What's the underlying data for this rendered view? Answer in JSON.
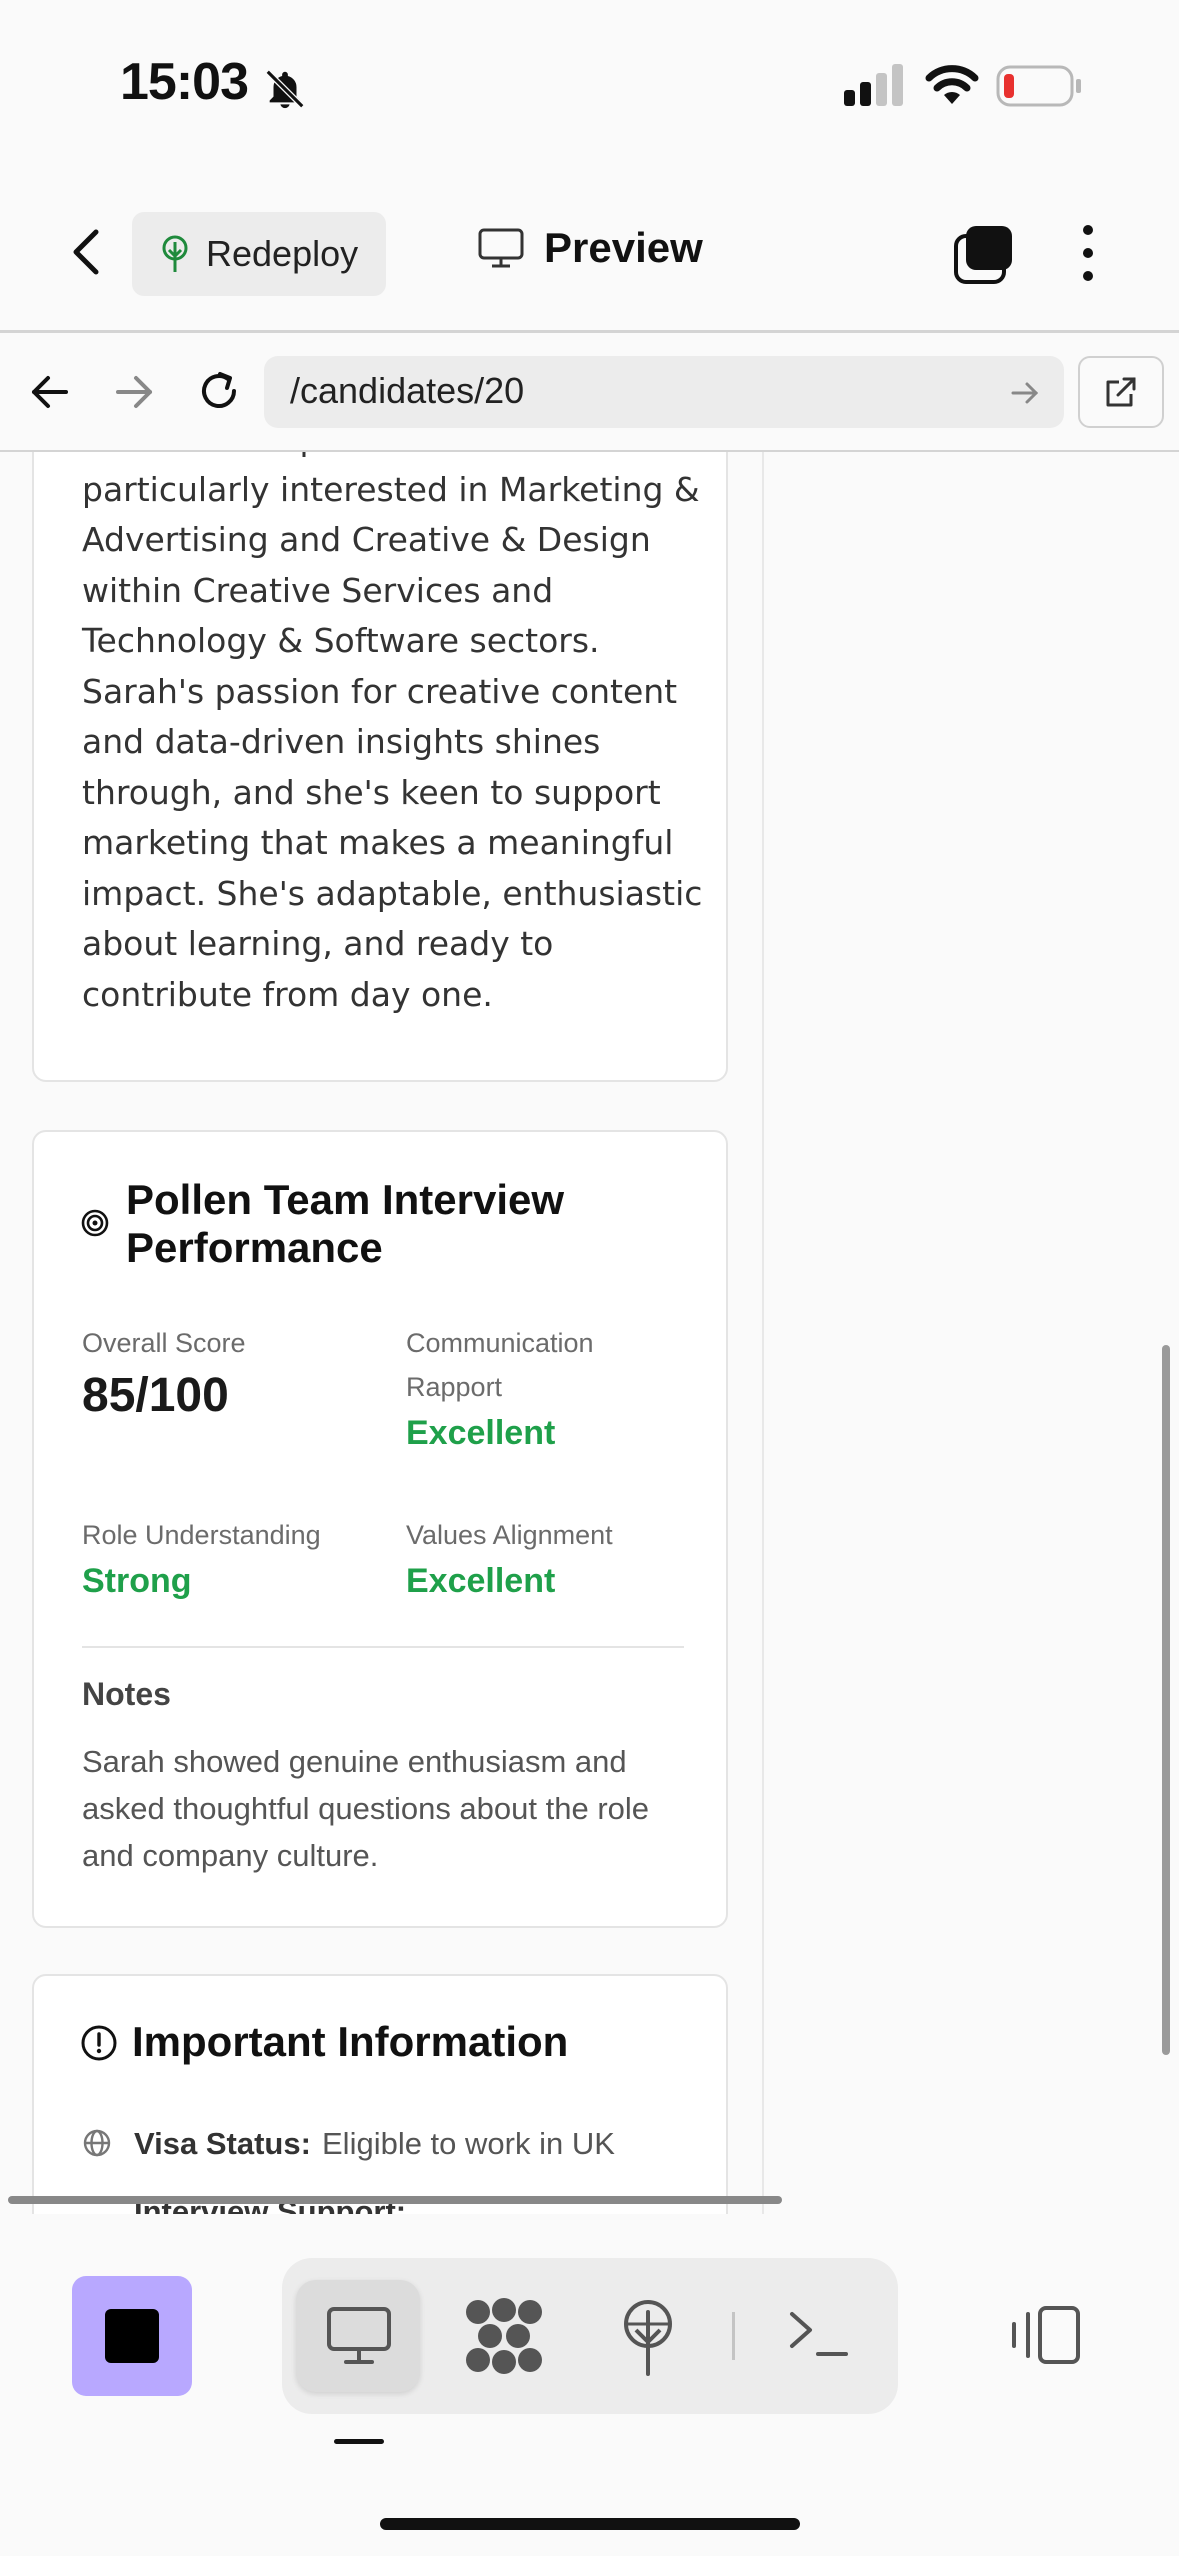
{
  "status_bar": {
    "time": "15:03"
  },
  "toolbar": {
    "redeploy_label": "Redeploy",
    "preview_label": "Preview"
  },
  "browser": {
    "url": "/candidates/20"
  },
  "bio_card": {
    "lines": [
      "enhance her professional work. She's",
      "particularly interested in Marketing &",
      "Advertising and Creative & Design",
      "within Creative Services and",
      "Technology & Software sectors.",
      "Sarah's passion for creative content",
      "and data-driven insights shines",
      "through, and she's keen to support",
      "marketing that makes a meaningful",
      "impact. She's adaptable, enthusiastic",
      "about learning, and ready to",
      "contribute from day one."
    ]
  },
  "interview_card": {
    "title_line1": "Pollen Team Interview",
    "title_line2": "Performance",
    "overall_label": "Overall Score",
    "overall_value": "85/100",
    "comm_label_1": "Communication",
    "comm_label_2": "Rapport",
    "comm_value": "Excellent",
    "role_label": "Role Understanding",
    "role_value": "Strong",
    "values_label": "Values Alignment",
    "values_value": "Excellent",
    "notes_heading": "Notes",
    "notes_text": "Sarah showed genuine enthusiasm and asked thoughtful questions about the role and company culture."
  },
  "info_card": {
    "title": "Important Information",
    "visa_label": "Visa Status:",
    "visa_value": "Eligible to work in UK",
    "support_label": "Interview Support:"
  },
  "colors": {
    "accent_green": "#1fa04a",
    "stop_button": "#b8a8ff"
  },
  "icons": [
    "bell-slash-icon",
    "signal-icon",
    "wifi-icon",
    "battery-icon",
    "chevron-left-icon",
    "sprout-icon",
    "monitor-icon",
    "tabs-icon",
    "more-vertical-icon",
    "arrow-left-icon",
    "arrow-right-icon",
    "reload-icon",
    "external-link-icon",
    "target-icon",
    "alert-circle-icon",
    "globe-icon",
    "stop-icon",
    "grid-blobs-icon",
    "terminal-icon",
    "sidebar-icon"
  ]
}
